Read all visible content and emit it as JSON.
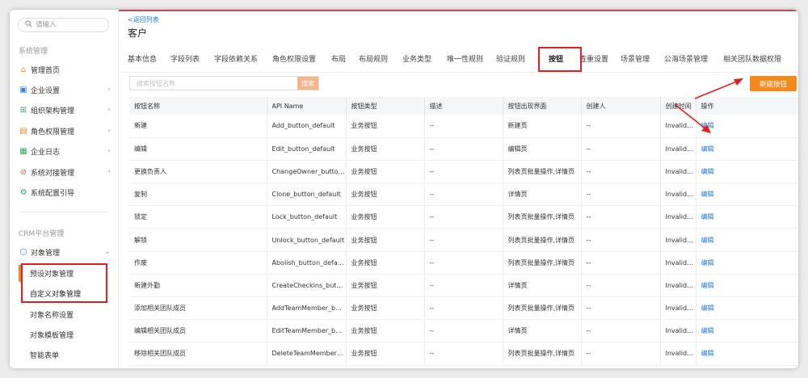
{
  "sidebar": {
    "search_placeholder": "请输入",
    "section_system": "系统管理",
    "system_items": [
      {
        "label": "管理首页",
        "icon": "home-icon"
      },
      {
        "label": "企业设置",
        "icon": "enterprise-icon"
      },
      {
        "label": "组织架构管理",
        "icon": "org-icon"
      },
      {
        "label": "角色权限管理",
        "icon": "role-icon"
      },
      {
        "label": "企业日志",
        "icon": "log-icon"
      },
      {
        "label": "系统对接管理",
        "icon": "integration-icon"
      },
      {
        "label": "系统配置引导",
        "icon": "guide-icon"
      }
    ],
    "section_crm": "CRM平台管理",
    "object_mgmt": "对象管理",
    "sub_items": [
      "预设对象管理",
      "自定义对象管理",
      "对象名称设置",
      "对象模板管理",
      "智能表单"
    ]
  },
  "main": {
    "back_link": "<返回列表",
    "title": "客户",
    "tabs": [
      "基本信息",
      "字段列表",
      "字段依赖关系",
      "角色权限设置",
      "布局",
      "布局规则",
      "业务类型",
      "唯一性规则",
      "验证规则",
      "按钮",
      "查重设置",
      "场景管理",
      "公海场景管理",
      "相关团队数据权限"
    ],
    "filter_placeholder": "搜索按钮名称",
    "filter_button": "搜索",
    "new_button": "新建按钮",
    "columns": [
      "按钮名称",
      "API Name",
      "按钮类型",
      "描述",
      "按钮出现界面",
      "创建人",
      "创建时间",
      "操作"
    ],
    "rows": [
      [
        "新建",
        "Add_button_default",
        "业务按钮",
        "--",
        "新建页",
        "--",
        "Invalid dat",
        "编辑"
      ],
      [
        "编辑",
        "Edit_button_default",
        "业务按钮",
        "--",
        "编辑页",
        "--",
        "Invalid dat",
        "编辑"
      ],
      [
        "更换负责人",
        "ChangeOwner_button_default",
        "业务按钮",
        "--",
        "列表页批量操作,详情页",
        "--",
        "Invalid dat",
        "编辑"
      ],
      [
        "复制",
        "Clone_button_default",
        "业务按钮",
        "--",
        "详情页",
        "--",
        "Invalid dat",
        "编辑"
      ],
      [
        "锁定",
        "Lock_button_default",
        "业务按钮",
        "--",
        "列表页批量操作,详情页",
        "--",
        "Invalid dat",
        "编辑"
      ],
      [
        "解锁",
        "Unlock_button_default",
        "业务按钮",
        "--",
        "列表页批量操作,详情页",
        "--",
        "Invalid dat",
        "编辑"
      ],
      [
        "作废",
        "Abolish_button_default",
        "业务按钮",
        "--",
        "列表页批量操作,详情页",
        "--",
        "Invalid dat",
        "编辑"
      ],
      [
        "新建外勤",
        "CreateCheckins_button_default",
        "业务按钮",
        "--",
        "详情页",
        "--",
        "Invalid dat",
        "编辑"
      ],
      [
        "添加相关团队成员",
        "AddTeamMember_button_default",
        "业务按钮",
        "--",
        "列表页批量操作,详情页",
        "--",
        "Invalid dat",
        "编辑"
      ],
      [
        "编辑相关团队成员",
        "EditTeamMember_button_default",
        "业务按钮",
        "--",
        "详情页",
        "--",
        "Invalid dat",
        "编辑"
      ],
      [
        "移除相关团队成员",
        "DeleteTeamMember_button_default",
        "业务按钮",
        "--",
        "列表页批量操作,详情页",
        "--",
        "Invalid dat",
        "编辑"
      ]
    ]
  },
  "colors": {
    "accent": "#f48a1c",
    "link": "#1e78d8",
    "annotation": "#e02020"
  }
}
